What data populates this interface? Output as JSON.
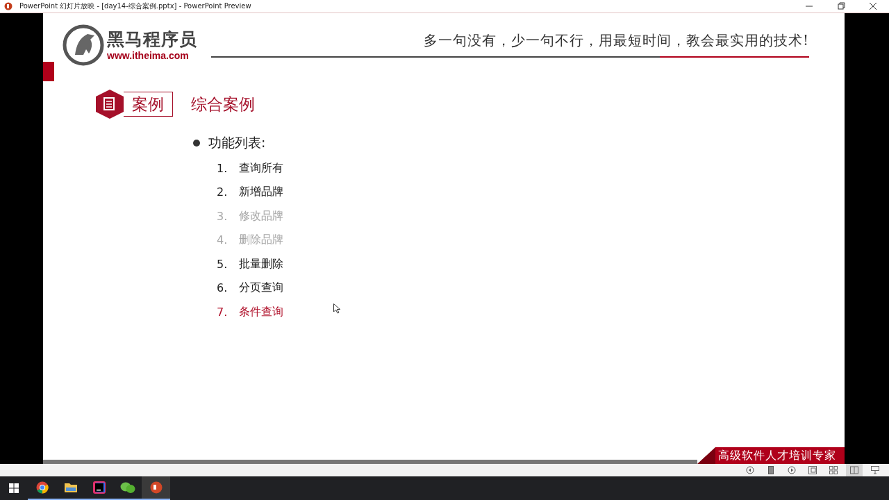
{
  "window": {
    "title": "PowerPoint 幻灯片放映 - [day14-综合案例.pptx] - PowerPoint Preview"
  },
  "slide": {
    "logo": {
      "name": "黑马程序员",
      "url": "www.itheima.com"
    },
    "slogan": "多一句没有，少一句不行，用最短时间，教会最实用的技术!",
    "tag": "案例",
    "heading": "综合案例",
    "bullet": "功能列表:",
    "items": [
      {
        "number": "1.",
        "text": "查询所有",
        "kind": "normal"
      },
      {
        "number": "2.",
        "text": "新增品牌",
        "kind": "normal"
      },
      {
        "number": "3.",
        "text": "修改品牌",
        "kind": "dimmed"
      },
      {
        "number": "4.",
        "text": "删除品牌",
        "kind": "dimmed"
      },
      {
        "number": "5.",
        "text": "批量删除",
        "kind": "normal"
      },
      {
        "number": "6.",
        "text": "分页查询",
        "kind": "normal"
      },
      {
        "number": "7.",
        "text": "条件查询",
        "kind": "current"
      }
    ],
    "footer": "高级软件人才培训专家"
  },
  "status_bar": {
    "views": [
      {
        "kind": "prev",
        "selected": false
      },
      {
        "kind": "pause",
        "selected": false
      },
      {
        "kind": "next",
        "selected": false
      },
      {
        "kind": "normal",
        "selected": false
      },
      {
        "kind": "sorter",
        "selected": false
      },
      {
        "kind": "reading",
        "selected": true
      },
      {
        "kind": "show",
        "selected": false
      }
    ]
  },
  "taskbar": {
    "apps": [
      {
        "kind": "chrome",
        "selected": false
      },
      {
        "kind": "folder",
        "selected": false
      },
      {
        "kind": "ide",
        "selected": false
      },
      {
        "kind": "chat",
        "selected": false
      },
      {
        "kind": "slides",
        "selected": true
      }
    ]
  }
}
